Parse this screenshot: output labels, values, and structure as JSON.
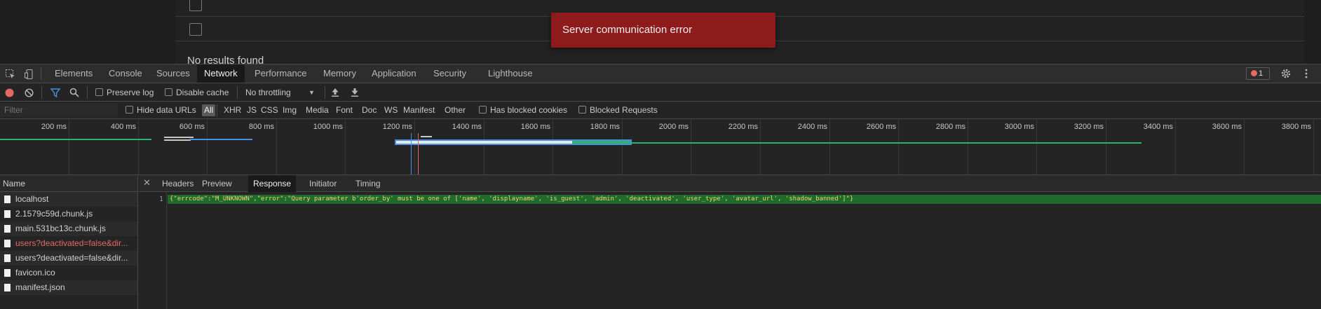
{
  "app": {
    "no_results": "No results found",
    "toast_message": "Server communication error"
  },
  "devtools": {
    "tabs": [
      "Elements",
      "Console",
      "Sources",
      "Network",
      "Performance",
      "Memory",
      "Application",
      "Security",
      "Lighthouse"
    ],
    "active_tab": "Network",
    "error_count": "1",
    "toolbar": {
      "preserve_log": "Preserve log",
      "disable_cache": "Disable cache",
      "throttling": "No throttling"
    },
    "filter": {
      "placeholder": "Filter",
      "hide_data_urls": "Hide data URLs",
      "types": [
        "All",
        "XHR",
        "JS",
        "CSS",
        "Img",
        "Media",
        "Font",
        "Doc",
        "WS",
        "Manifest",
        "Other"
      ],
      "active_type": "All",
      "has_blocked_cookies": "Has blocked cookies",
      "blocked_requests": "Blocked Requests"
    },
    "timeline_ticks": [
      "200 ms",
      "400 ms",
      "600 ms",
      "800 ms",
      "1000 ms",
      "1200 ms",
      "1400 ms",
      "1600 ms",
      "1800 ms",
      "2000 ms",
      "2200 ms",
      "2400 ms",
      "2600 ms",
      "2800 ms",
      "3000 ms",
      "3200 ms",
      "3400 ms",
      "3600 ms",
      "3800 ms"
    ],
    "colors": {
      "recording": "#e46962",
      "response_bar": "#1e6b2b",
      "waiting_green": "#2fb36b",
      "download_blue": "#4a90e2"
    },
    "requests": {
      "header": "Name",
      "rows": [
        {
          "name": "localhost",
          "error": false
        },
        {
          "name": "2.1579c59d.chunk.js",
          "error": false
        },
        {
          "name": "main.531bc13c.chunk.js",
          "error": false
        },
        {
          "name": "users?deactivated=false&dir...",
          "error": true
        },
        {
          "name": "users?deactivated=false&dir...",
          "error": false
        },
        {
          "name": "favicon.ico",
          "error": false
        },
        {
          "name": "manifest.json",
          "error": false
        }
      ]
    },
    "detail": {
      "tabs": [
        "Headers",
        "Preview",
        "Response",
        "Initiator",
        "Timing"
      ],
      "active_tab": "Response",
      "line_number": "1",
      "response_text": "{\"errcode\":\"M_UNKNOWN\",\"error\":\"Query parameter b'order_by' must be one of ['name', 'displayname', 'is_guest', 'admin', 'deactivated', 'user_type', 'avatar_url', 'shadow_banned']\"}"
    }
  }
}
